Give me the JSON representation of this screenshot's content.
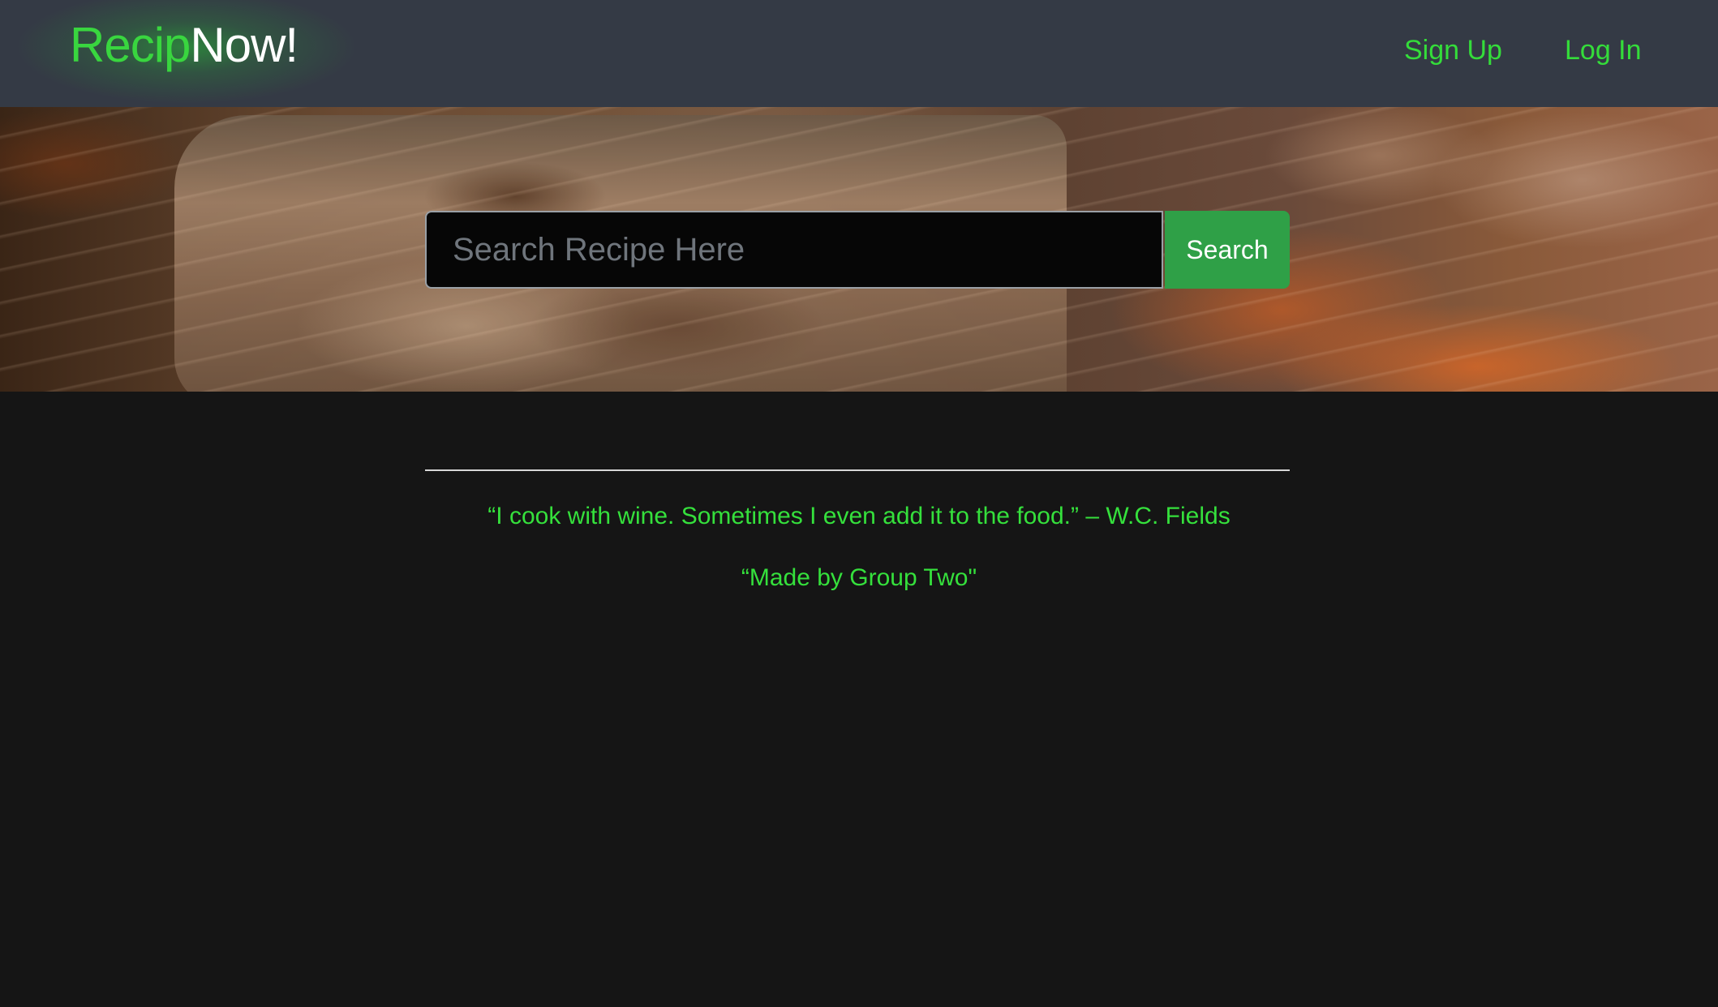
{
  "header": {
    "brand_part1": "Recip",
    "brand_part2": "Now!",
    "nav": {
      "signup": "Sign Up",
      "login": "Log In"
    }
  },
  "hero": {
    "search": {
      "placeholder": "Search Recipe Here",
      "value": "",
      "button_label": "Search"
    }
  },
  "footer": {
    "quote": "“I cook with wine. Sometimes I even add it to the food.” – W.C. Fields",
    "credit": "“Made by Group Two\""
  },
  "colors": {
    "accent_green": "#35e03c",
    "navbar_bg": "#343a45",
    "page_bg": "#151515",
    "button_green": "#2fa047"
  }
}
